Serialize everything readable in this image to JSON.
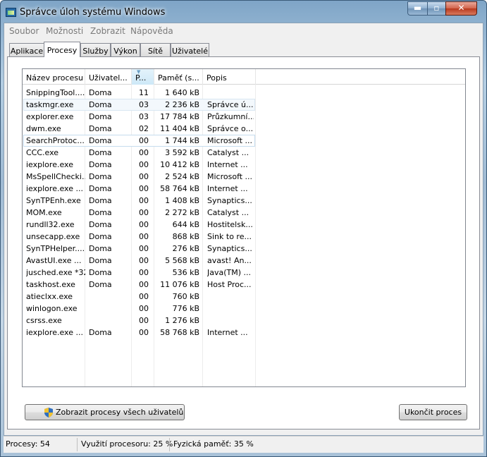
{
  "window": {
    "title": "Správce úloh systému Windows",
    "min_glyph": "▬",
    "max_glyph": "▫",
    "close_glyph": "✕"
  },
  "menu": [
    "Soubor",
    "Možnosti",
    "Zobrazit",
    "Nápověda"
  ],
  "tabs": [
    {
      "label": "Aplikace",
      "active": false
    },
    {
      "label": "Procesy",
      "active": true
    },
    {
      "label": "Služby",
      "active": false
    },
    {
      "label": "Výkon",
      "active": false
    },
    {
      "label": "Sítě",
      "active": false
    },
    {
      "label": "Uživatelé",
      "active": false
    }
  ],
  "columns": [
    "Název procesu",
    "Uživatel...",
    "P...",
    "Paměť (s...",
    "Popis"
  ],
  "sorted_column": 2,
  "rows": [
    {
      "name": "SnippingTool....",
      "user": "Doma",
      "cpu": "11",
      "mem": "1 640 kB",
      "desc": ""
    },
    {
      "name": "taskmgr.exe",
      "user": "Doma",
      "cpu": "03",
      "mem": "2 236 kB",
      "desc": "Správce ú...",
      "state": "hl"
    },
    {
      "name": "explorer.exe",
      "user": "Doma",
      "cpu": "03",
      "mem": "17 784 kB",
      "desc": "Průzkumní..."
    },
    {
      "name": "dwm.exe",
      "user": "Doma",
      "cpu": "02",
      "mem": "11 404 kB",
      "desc": "Správce o..."
    },
    {
      "name": "SearchProtoc...",
      "user": "Doma",
      "cpu": "00",
      "mem": "1 744 kB",
      "desc": "Microsoft ...",
      "state": "sel"
    },
    {
      "name": "CCC.exe",
      "user": "Doma",
      "cpu": "00",
      "mem": "3 592 kB",
      "desc": "Catalyst ..."
    },
    {
      "name": "iexplore.exe",
      "user": "Doma",
      "cpu": "00",
      "mem": "10 412 kB",
      "desc": "Internet ..."
    },
    {
      "name": "MsSpellChecki...",
      "user": "Doma",
      "cpu": "00",
      "mem": "2 524 kB",
      "desc": "Microsoft ..."
    },
    {
      "name": "iexplore.exe ...",
      "user": "Doma",
      "cpu": "00",
      "mem": "58 764 kB",
      "desc": "Internet ..."
    },
    {
      "name": "SynTPEnh.exe",
      "user": "Doma",
      "cpu": "00",
      "mem": "1 408 kB",
      "desc": "Synaptics..."
    },
    {
      "name": "MOM.exe",
      "user": "Doma",
      "cpu": "00",
      "mem": "2 272 kB",
      "desc": "Catalyst ..."
    },
    {
      "name": "rundll32.exe",
      "user": "Doma",
      "cpu": "00",
      "mem": "644 kB",
      "desc": "Hostitelsk..."
    },
    {
      "name": "unsecapp.exe",
      "user": "Doma",
      "cpu": "00",
      "mem": "868 kB",
      "desc": "Sink to re..."
    },
    {
      "name": "SynTPHelper....",
      "user": "Doma",
      "cpu": "00",
      "mem": "276 kB",
      "desc": "Synaptics..."
    },
    {
      "name": "AvastUI.exe ...",
      "user": "Doma",
      "cpu": "00",
      "mem": "5 568 kB",
      "desc": "avast! An..."
    },
    {
      "name": "jusched.exe *32",
      "user": "Doma",
      "cpu": "00",
      "mem": "536 kB",
      "desc": "Java(TM) ..."
    },
    {
      "name": "taskhost.exe",
      "user": "Doma",
      "cpu": "00",
      "mem": "11 076 kB",
      "desc": "Host Proc..."
    },
    {
      "name": "atieclxx.exe",
      "user": "",
      "cpu": "00",
      "mem": "760 kB",
      "desc": ""
    },
    {
      "name": "winlogon.exe",
      "user": "",
      "cpu": "00",
      "mem": "776 kB",
      "desc": ""
    },
    {
      "name": "csrss.exe",
      "user": "",
      "cpu": "00",
      "mem": "1 276 kB",
      "desc": ""
    },
    {
      "name": "iexplore.exe ...",
      "user": "Doma",
      "cpu": "00",
      "mem": "58 768 kB",
      "desc": "Internet ..."
    }
  ],
  "buttons": {
    "show_all": "Zobrazit procesy všech uživatelů",
    "end_process": "Ukončit proces"
  },
  "status": {
    "processes": "Procesy: 54",
    "cpu": "Využití procesoru: 25 %",
    "memory": "Fyzická paměť: 35 %"
  },
  "colors": {
    "selection_border": "#d8e6f2",
    "sorted_header": "#cde8f7",
    "menu_text_disabled": "#7a7a7a"
  }
}
